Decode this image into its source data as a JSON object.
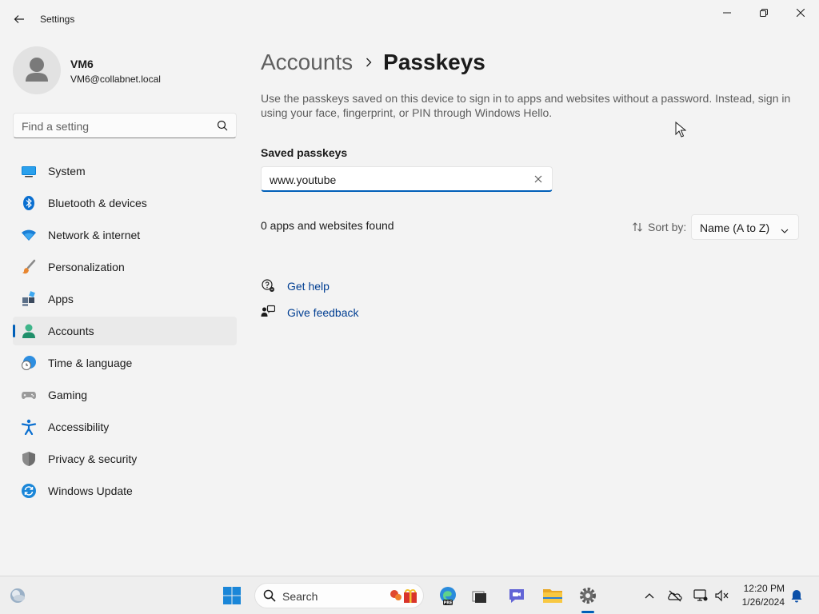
{
  "window": {
    "title": "Settings",
    "back_icon": "back-arrow-icon",
    "minimize_icon": "minimize-icon",
    "maximize_icon": "restore-icon",
    "close_icon": "close-icon"
  },
  "profile": {
    "name": "VM6",
    "email": "VM6@collabnet.local",
    "avatar_icon": "user-avatar-icon"
  },
  "search": {
    "placeholder": "Find a setting",
    "icon": "search-icon"
  },
  "sidebar": {
    "items": [
      {
        "label": "System",
        "icon": "system-icon",
        "active": false
      },
      {
        "label": "Bluetooth & devices",
        "icon": "bluetooth-icon",
        "active": false
      },
      {
        "label": "Network & internet",
        "icon": "wifi-icon",
        "active": false
      },
      {
        "label": "Personalization",
        "icon": "paintbrush-icon",
        "active": false
      },
      {
        "label": "Apps",
        "icon": "apps-icon",
        "active": false
      },
      {
        "label": "Accounts",
        "icon": "accounts-icon",
        "active": true
      },
      {
        "label": "Time & language",
        "icon": "clock-globe-icon",
        "active": false
      },
      {
        "label": "Gaming",
        "icon": "gamepad-icon",
        "active": false
      },
      {
        "label": "Accessibility",
        "icon": "accessibility-icon",
        "active": false
      },
      {
        "label": "Privacy & security",
        "icon": "shield-icon",
        "active": false
      },
      {
        "label": "Windows Update",
        "icon": "windows-update-icon",
        "active": false
      }
    ]
  },
  "breadcrumb": {
    "parent": "Accounts",
    "current": "Passkeys"
  },
  "main": {
    "description": "Use the passkeys saved on this device to sign in to apps and websites without a password. Instead, sign in using your face, fingerprint, or PIN through Windows Hello.",
    "section_title": "Saved passkeys",
    "passkey_search_value": "www.youtube",
    "results_count": "0 apps and websites found",
    "sort_label": "Sort by:",
    "sort_value": "Name (A to Z)",
    "links": {
      "get_help": "Get help",
      "give_feedback": "Give feedback"
    }
  },
  "taskbar": {
    "search_label": "Search",
    "time": "12:20 PM",
    "date": "1/26/2024"
  },
  "colors": {
    "accent": "#005fb8",
    "link": "#003e92",
    "background": "#f3f3f3"
  }
}
